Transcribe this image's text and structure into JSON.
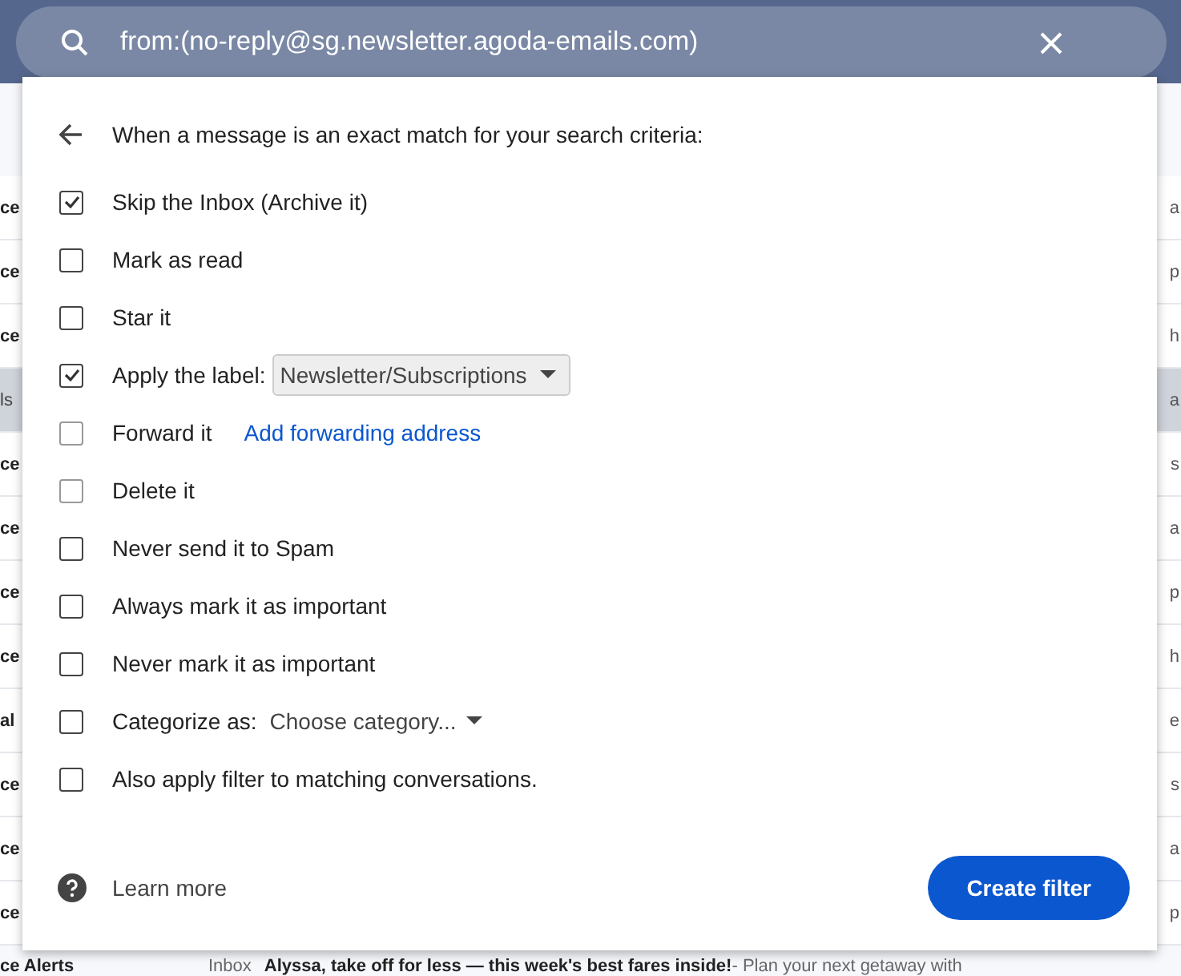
{
  "search": {
    "value": "from:(no-reply@sg.newsletter.agoda-emails.com)"
  },
  "background_rows": [
    {
      "left": "ce",
      "right": "a",
      "selected": false
    },
    {
      "left": "ce",
      "right": "p",
      "selected": false
    },
    {
      "left": "ce",
      "right": "h",
      "selected": false
    },
    {
      "left": "ls",
      "right": "a",
      "selected": true
    },
    {
      "left": "ce",
      "right": "s",
      "selected": false
    },
    {
      "left": "ce",
      "right": "a",
      "selected": false
    },
    {
      "left": "ce",
      "right": "p",
      "selected": false
    },
    {
      "left": "ce",
      "right": "h",
      "selected": false
    },
    {
      "left": "al",
      "right": "e",
      "selected": false
    },
    {
      "left": "ce",
      "right": "s",
      "selected": false
    },
    {
      "left": "ce",
      "right": "a",
      "selected": false
    },
    {
      "left": "ce",
      "right": "p",
      "selected": false
    }
  ],
  "bottom_row": {
    "sender": "ce Alerts",
    "label": "Inbox",
    "subject": "Alyssa, take off for less — this week's best fares inside!",
    "snippet": " - Plan your next getaway with"
  },
  "dialog": {
    "heading": "When a message is an exact match for your search criteria:",
    "options": [
      {
        "kind": "plain",
        "label": "Skip the Inbox (Archive it)",
        "checked": true,
        "disabled": false
      },
      {
        "kind": "plain",
        "label": "Mark as read",
        "checked": false,
        "disabled": false
      },
      {
        "kind": "plain",
        "label": "Star it",
        "checked": false,
        "disabled": false
      },
      {
        "kind": "select",
        "label": "Apply the label:",
        "checked": true,
        "disabled": false,
        "select": "Newsletter/Subscriptions"
      },
      {
        "kind": "link",
        "label": "Forward it",
        "checked": false,
        "disabled": true,
        "link": "Add forwarding address"
      },
      {
        "kind": "plain",
        "label": "Delete it",
        "checked": false,
        "disabled": true
      },
      {
        "kind": "plain",
        "label": "Never send it to Spam",
        "checked": false,
        "disabled": false
      },
      {
        "kind": "plain",
        "label": "Always mark it as important",
        "checked": false,
        "disabled": false
      },
      {
        "kind": "plain",
        "label": "Never mark it as important",
        "checked": false,
        "disabled": false
      },
      {
        "kind": "dropdown",
        "label": "Categorize as:",
        "checked": false,
        "disabled": false,
        "select": "Choose category..."
      },
      {
        "kind": "plain",
        "label": "Also apply filter to matching conversations.",
        "checked": false,
        "disabled": false
      }
    ],
    "learn_more": "Learn more",
    "button": "Create filter"
  }
}
